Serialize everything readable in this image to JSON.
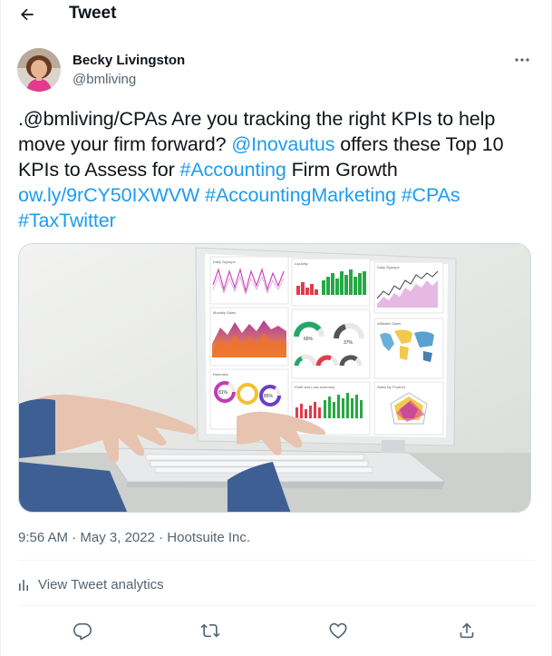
{
  "header": {
    "back_icon": "arrow-left-icon",
    "title": "Tweet"
  },
  "author": {
    "name": "Becky Livingston",
    "handle": "@bmliving",
    "more_icon": "more-horizontal-icon"
  },
  "tweet": {
    "segments": [
      {
        "text": ".@bmliving/CPAs Are you tracking the right KPIs to help move your firm forward? ",
        "link": false
      },
      {
        "text": "@Inovautus",
        "link": true
      },
      {
        "text": " offers these Top 10 KPIs to Assess for ",
        "link": false
      },
      {
        "text": "#Accounting",
        "link": true
      },
      {
        "text": " Firm Growth ",
        "link": false
      },
      {
        "text": "ow.ly/9rCY50IXWVW",
        "link": true
      },
      {
        "text": " ",
        "link": false
      },
      {
        "text": "#AccountingMarketing",
        "link": true
      },
      {
        "text": " ",
        "link": false
      },
      {
        "text": "#CPAs",
        "link": true
      },
      {
        "text": " ",
        "link": false
      },
      {
        "text": "#TaxTwitter",
        "link": true
      }
    ],
    "media": {
      "dashboard_tiles": [
        "Daily Signups",
        "Liquidity",
        "Daily Signups",
        "Monthly Sales",
        "Affiliates Sales",
        "Retention",
        "Profit and Loss summary",
        "Sales By Product"
      ],
      "gauge_values": [
        "65%",
        "37%",
        "81%",
        "85%"
      ]
    }
  },
  "meta": {
    "time": "9:56 AM",
    "sep1": " · ",
    "date": "May 3, 2022",
    "sep2": " · ",
    "source": "Hootsuite Inc."
  },
  "analytics": {
    "icon": "bar-chart-icon",
    "label": "View Tweet analytics"
  },
  "actions": [
    {
      "name": "reply",
      "icon": "reply-icon"
    },
    {
      "name": "retweet",
      "icon": "retweet-icon"
    },
    {
      "name": "like",
      "icon": "heart-icon"
    },
    {
      "name": "share",
      "icon": "share-icon"
    }
  ],
  "colors": {
    "link": "#1d9bf0",
    "text": "#0f1419",
    "muted": "#536471",
    "border": "#eff3f4"
  }
}
